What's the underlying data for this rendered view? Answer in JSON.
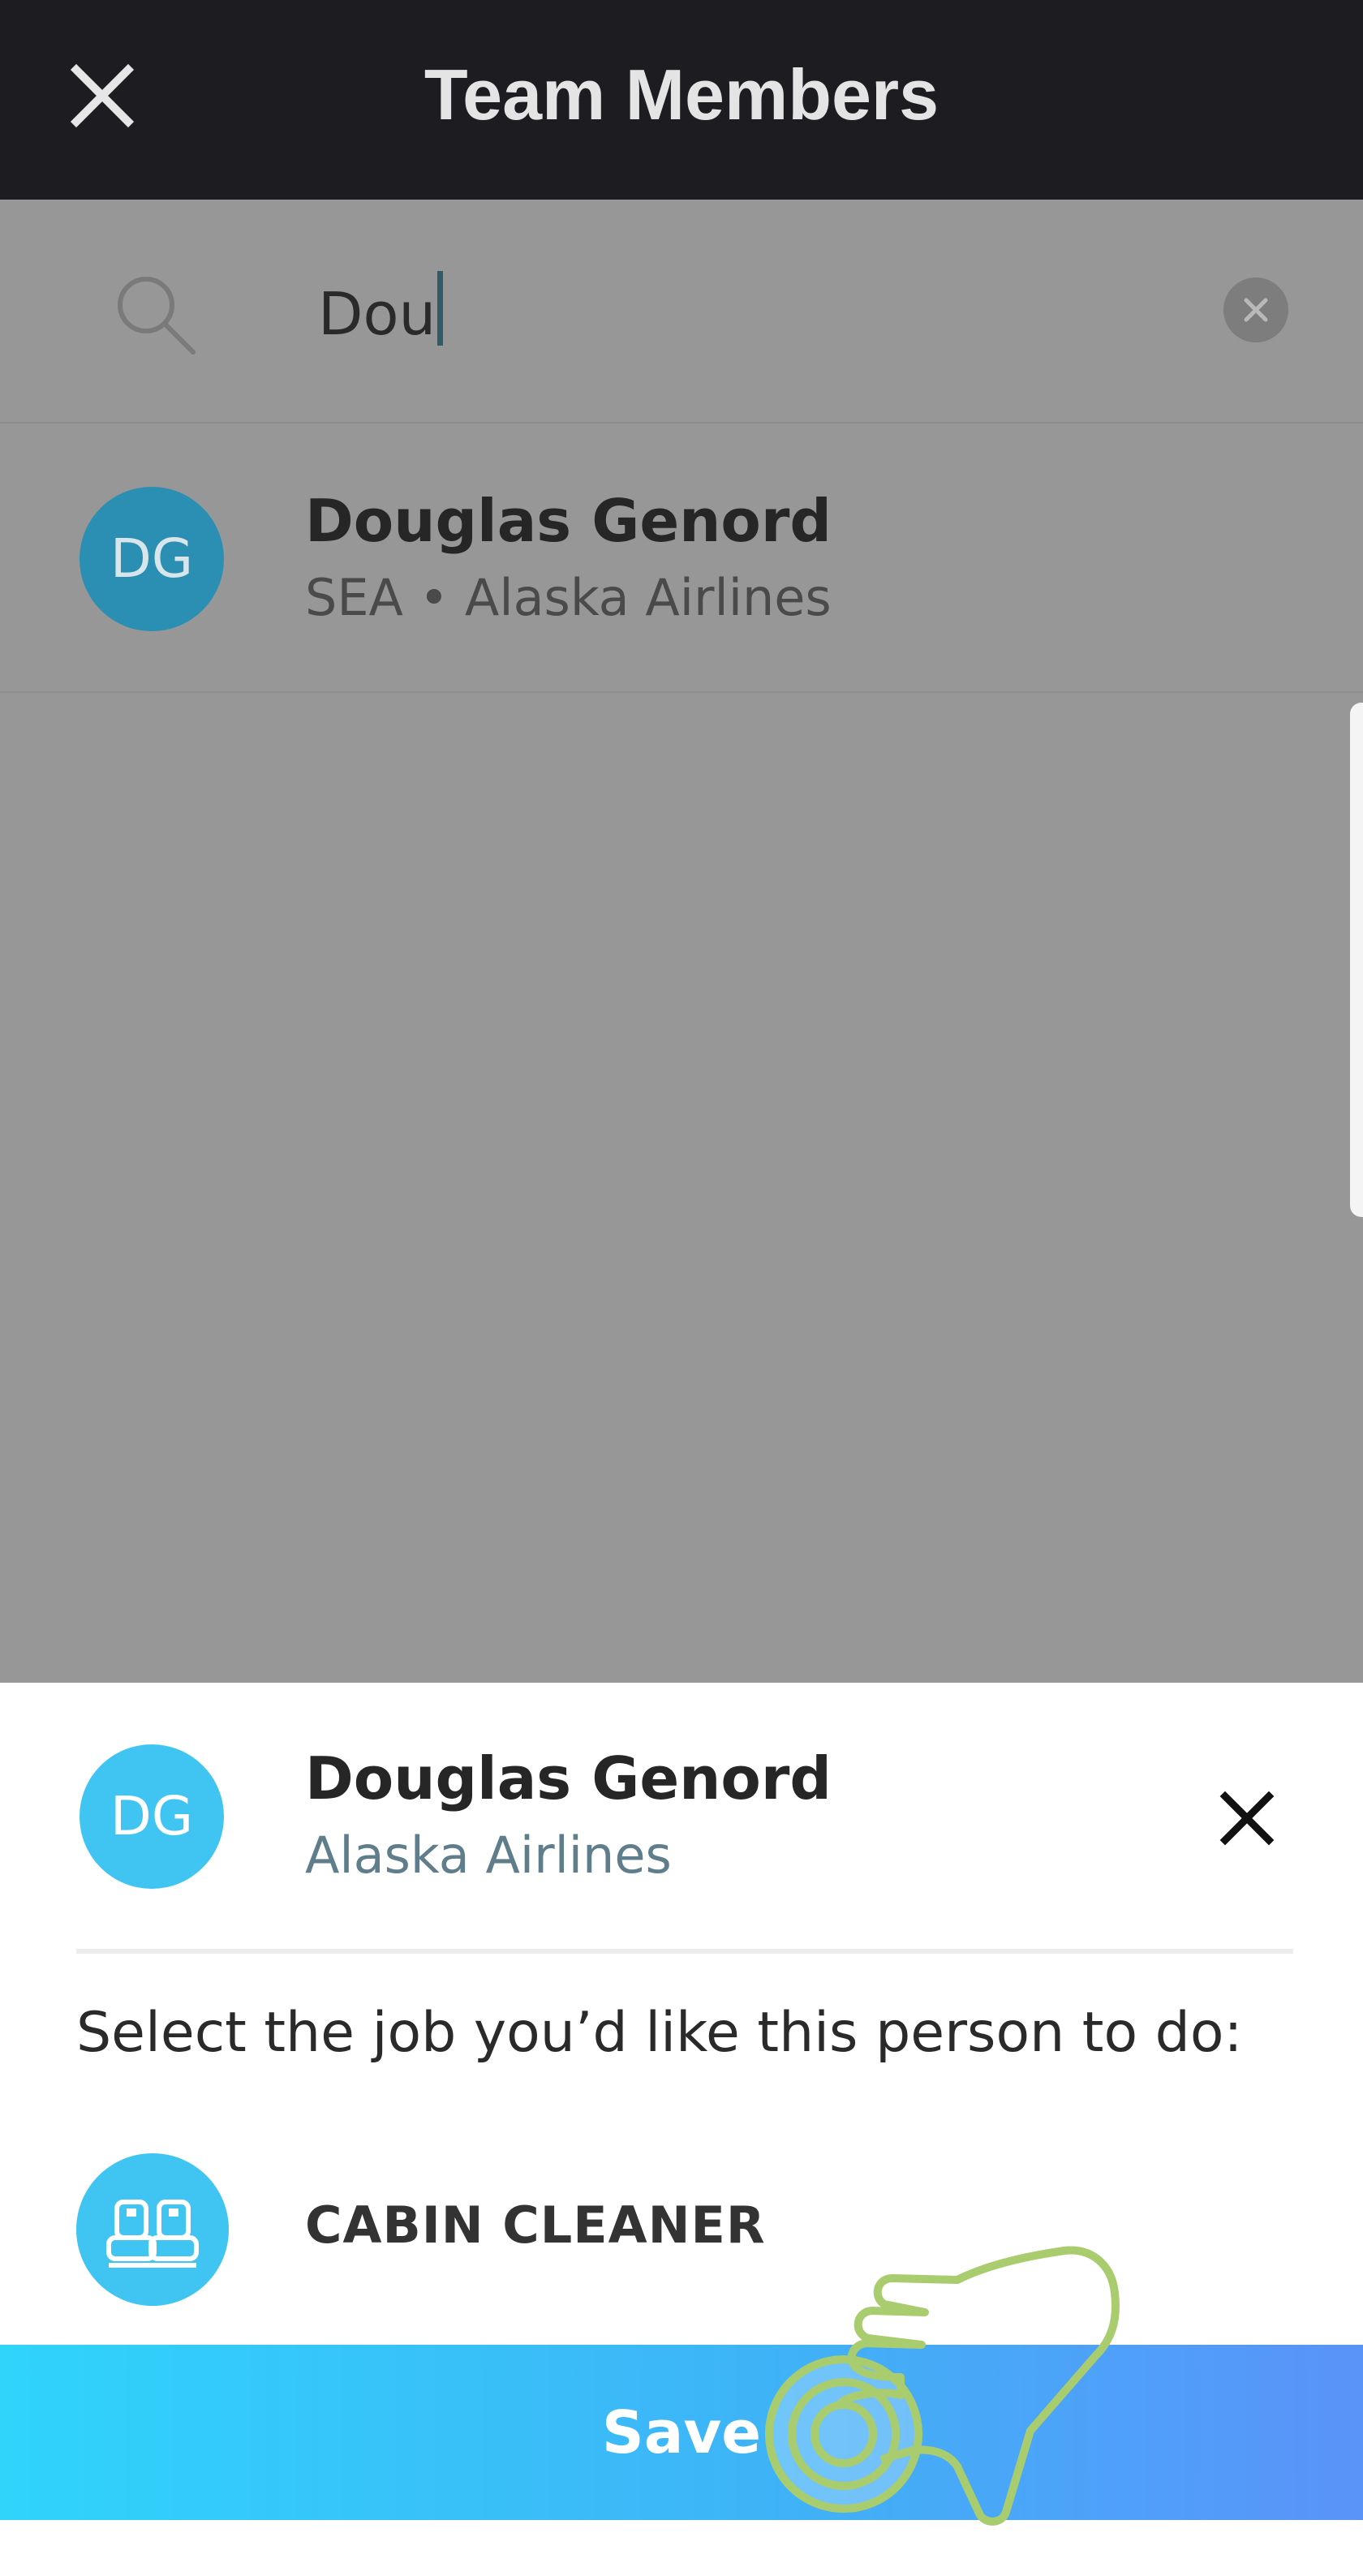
{
  "header": {
    "title": "Team Members",
    "close_icon": "close-icon"
  },
  "search": {
    "value": "Dou",
    "search_icon": "search-icon",
    "clear_icon": "clear-circle-icon"
  },
  "results": [
    {
      "initials": "DG",
      "name": "Douglas Genord",
      "subtitle": "SEA • Alaska Airlines"
    }
  ],
  "sheet": {
    "initials": "DG",
    "name": "Douglas Genord",
    "company": "Alaska Airlines",
    "close_icon": "close-icon",
    "prompt": "Select the job you’d like this person to do:",
    "job": {
      "icon": "seats-icon",
      "label": "CABIN CLEANER"
    },
    "save_label": "Save"
  },
  "colors": {
    "header_bg": "#1d1c21",
    "overlay_bg": "#979797",
    "accent": "#40c5f2",
    "save_gradient_start": "#2fd4fb",
    "save_gradient_end": "#5a93f8",
    "hand_outline": "#a9cd6e"
  }
}
